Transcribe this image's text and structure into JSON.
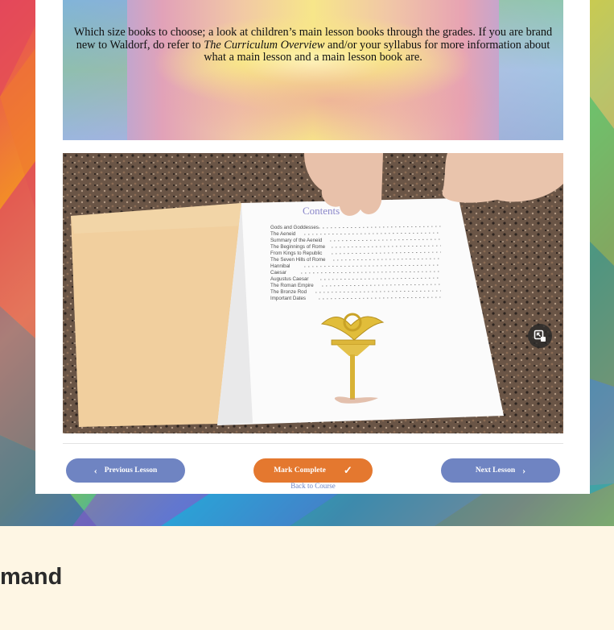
{
  "lesson": {
    "intro_text_part1": "Which size books to choose; a look at children’s main lesson books through the grades. If you are brand new to Waldorf, do refer to ",
    "intro_text_italic": "The Curriculum Overview",
    "intro_text_part2": " and/or your syllabus for more information about what a main lesson and a main lesson book are.",
    "photo_page_heading": "Contents",
    "contents_entries": [
      "Gods and Goddesses",
      "The Aeneid",
      "Summary of the Aeneid",
      "The Beginnings of Rome",
      "From Kings to Republic",
      "The Seven Hills of Rome",
      "Hannibal",
      "Caesar",
      "Augustus Caesar",
      "The Roman Empire",
      "The Bronze Rod",
      "Important Dates"
    ]
  },
  "navigation": {
    "previous_label": "Previous Lesson",
    "complete_label": "Mark Complete",
    "next_label": "Next Lesson",
    "back_label": "Back to Course"
  },
  "icons": {
    "previous": "chevron-left-icon",
    "complete": "check-icon",
    "next": "chevron-right-icon",
    "expand": "expand-image-icon"
  },
  "colors": {
    "nav_button": "#6f84c2",
    "complete_button": "#e4782f",
    "page_background": "#fef6e4"
  },
  "footer": {
    "heading_fragment": "mand"
  }
}
